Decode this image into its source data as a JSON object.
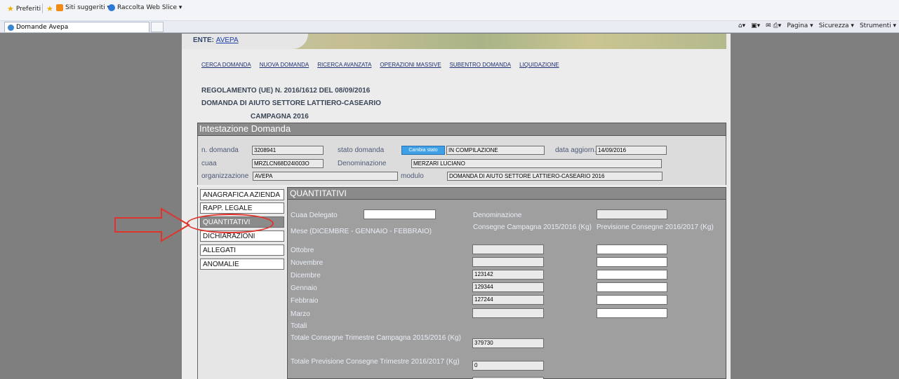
{
  "browser": {
    "favorites_label": "Preferiti",
    "suggested_label": "Siti suggeriti ▾",
    "webslice_label": "Raccolta Web Slice ▾",
    "tab_title": "Domande Avepa",
    "cmd_items": [
      "▾",
      "▾",
      "▾",
      "Pagina ▾",
      "Sicurezza ▾",
      "Strumenti ▾"
    ]
  },
  "header": {
    "ente_label": "ENTE:",
    "ente_value": "AVEPA"
  },
  "nav": [
    "CERCA DOMANDA",
    "NUOVA DOMANDA",
    "RICERCA AVANZATA",
    "OPERAZIONI MASSIVE",
    "SUBENTRO DOMANDA",
    "LIQUIDAZIONE"
  ],
  "titles": {
    "line1": "REGOLAMENTO (UE) N. 2016/1612 DEL 08/09/2016",
    "line2": "DOMANDA DI AIUTO SETTORE LATTIERO-CASEARIO",
    "line3": "CAMPAGNA 2016"
  },
  "intestazione": {
    "heading": "Intestazione Domanda",
    "n_domanda_label": "n. domanda",
    "n_domanda_value": "3208941",
    "stato_label": "stato domanda",
    "cambia_stato_button": "Cambia stato",
    "stato_value": "IN COMPILAZIONE",
    "data_aggiorn_label": "data aggiorn.",
    "data_aggiorn_value": "14/09/2016",
    "cuaa_label": "cuaa",
    "cuaa_value": "MRZLCN68D24I003O",
    "denominazione_label": "Denominazione",
    "denominazione_value": "MERZARI LUCIANO",
    "organizzazione_label": "organizzazione",
    "organizzazione_value": "AVEPA",
    "modulo_label": "modulo",
    "modulo_value": "DOMANDA DI AIUTO SETTORE LATTIERO-CASEARIO 2016"
  },
  "side_menu": [
    {
      "label": "ANAGRAFICA AZIENDA",
      "active": false
    },
    {
      "label": "RAPP. LEGALE",
      "active": false
    },
    {
      "label": "QUANTITATIVI",
      "active": true
    },
    {
      "label": "DICHIARAZIONI",
      "active": false
    },
    {
      "label": "ALLEGATI",
      "active": false
    },
    {
      "label": "ANOMALIE",
      "active": false
    }
  ],
  "quantitativi": {
    "heading": "QUANTITATIVI",
    "cuaa_delegato_label": "Cuaa Delegato",
    "cuaa_delegato_value": "",
    "denominazione_label": "Denominazione",
    "denominazione_value": "",
    "mese_header": "Mese (DICEMBRE - GENNAIO - FEBBRAIO)",
    "consegne_header": "Consegne Campagna 2015/2016 (Kg)",
    "previsione_header": "Previsione Consegne 2016/2017 (Kg)",
    "rows": [
      {
        "month": "Ottobre",
        "consegne": "",
        "previsione": ""
      },
      {
        "month": "Novembre",
        "consegne": "",
        "previsione": ""
      },
      {
        "month": "Dicembre",
        "consegne": "123142",
        "previsione": ""
      },
      {
        "month": "Gennaio",
        "consegne": "129344",
        "previsione": ""
      },
      {
        "month": "Febbraio",
        "consegne": "127244",
        "previsione": ""
      },
      {
        "month": "Marzo",
        "consegne": "",
        "previsione": ""
      }
    ],
    "totali_label": "Totali",
    "totale_consegne_label": "Totale Consegne Trimestre Campagna 2015/2016 (Kg)",
    "totale_consegne_value": "379730",
    "totale_previsione_label": "Totale Previsione Consegne Trimestre 2016/2017 (Kg)",
    "totale_previsione_value": "0"
  },
  "annotation_color": "#e0332c"
}
